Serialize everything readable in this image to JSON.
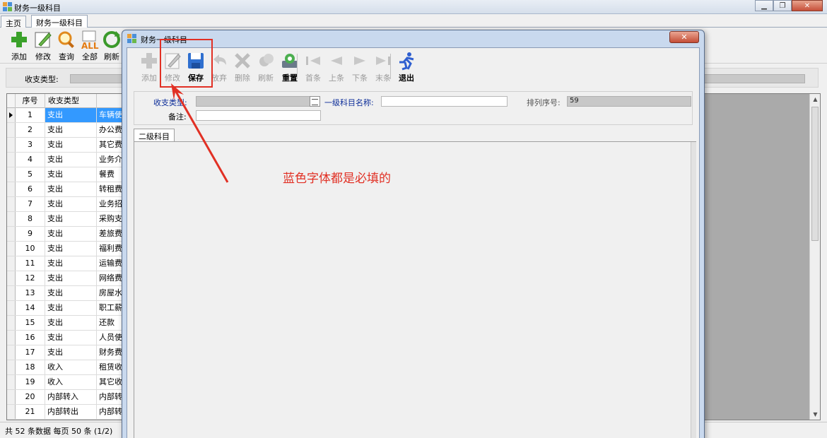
{
  "main_window": {
    "title": "财务一级科目",
    "controls": [
      "▁",
      "❐",
      "✕"
    ]
  },
  "tabs": [
    {
      "label": "主页",
      "active": false
    },
    {
      "label": "财务一级科目",
      "active": true
    }
  ],
  "main_toolbar": {
    "buttons": [
      {
        "label": "添加",
        "icon": "add-icon"
      },
      {
        "label": "修改",
        "icon": "edit-icon"
      },
      {
        "label": "查询",
        "icon": "search-icon"
      },
      {
        "label": "全部",
        "icon": "all-icon"
      },
      {
        "label": "刷新",
        "icon": "refresh-icon"
      }
    ]
  },
  "filter": {
    "label": "收支类型:"
  },
  "grid": {
    "columns": [
      "序号",
      "收支类型"
    ],
    "rows": [
      {
        "no": "1",
        "type": "支出",
        "name": "车辆使"
      },
      {
        "no": "2",
        "type": "支出",
        "name": "办公费"
      },
      {
        "no": "3",
        "type": "支出",
        "name": "其它费"
      },
      {
        "no": "4",
        "type": "支出",
        "name": "业务介"
      },
      {
        "no": "5",
        "type": "支出",
        "name": "餐费"
      },
      {
        "no": "6",
        "type": "支出",
        "name": "转租费"
      },
      {
        "no": "7",
        "type": "支出",
        "name": "业务招"
      },
      {
        "no": "8",
        "type": "支出",
        "name": "采购支"
      },
      {
        "no": "9",
        "type": "支出",
        "name": "差旅费"
      },
      {
        "no": "10",
        "type": "支出",
        "name": "福利费"
      },
      {
        "no": "11",
        "type": "支出",
        "name": "运输费"
      },
      {
        "no": "12",
        "type": "支出",
        "name": "网络费"
      },
      {
        "no": "13",
        "type": "支出",
        "name": "房屋水"
      },
      {
        "no": "14",
        "type": "支出",
        "name": "职工薪"
      },
      {
        "no": "15",
        "type": "支出",
        "name": "还款"
      },
      {
        "no": "16",
        "type": "支出",
        "name": "人员使"
      },
      {
        "no": "17",
        "type": "支出",
        "name": "财务费"
      },
      {
        "no": "18",
        "type": "收入",
        "name": "租赁收"
      },
      {
        "no": "19",
        "type": "收入",
        "name": "其它收"
      },
      {
        "no": "20",
        "type": "内部转入",
        "name": "内部转"
      },
      {
        "no": "21",
        "type": "内部转出",
        "name": "内部转"
      }
    ]
  },
  "status": "共 52 条数据  每页 50 条 (1/2)",
  "dialog": {
    "title": "财务一级科目",
    "close_label": "✕",
    "toolbar": [
      {
        "label": "添加",
        "icon": "add-icon",
        "enabled": false
      },
      {
        "label": "修改",
        "icon": "edit-icon",
        "enabled": false
      },
      {
        "label": "保存",
        "icon": "save-icon",
        "enabled": true
      },
      {
        "label": "放弃",
        "icon": "undo-icon",
        "enabled": false
      },
      {
        "label": "删除",
        "icon": "delete-icon",
        "enabled": false
      },
      {
        "label": "刷新",
        "icon": "refresh-icon",
        "enabled": false
      },
      {
        "label": "重置",
        "icon": "reset-icon",
        "enabled": true
      },
      {
        "label": "首条",
        "icon": "first-icon",
        "enabled": false
      },
      {
        "label": "上条",
        "icon": "prev-icon",
        "enabled": false
      },
      {
        "label": "下条",
        "icon": "next-icon",
        "enabled": false
      },
      {
        "label": "末条",
        "icon": "last-icon",
        "enabled": false
      },
      {
        "label": "退出",
        "icon": "exit-icon",
        "enabled": true
      }
    ],
    "form": {
      "type_label": "收支类型:",
      "name_label": "一级科目名称:",
      "name_value": "",
      "sort_label": "排列序号:",
      "sort_value": "59",
      "note_label": "备注:",
      "note_value": ""
    },
    "subtab": "二级科目"
  },
  "annotation": {
    "text": "蓝色字体都是必填的",
    "color": "#e13024"
  },
  "colors": {
    "required_label": "#0b2c98",
    "selection": "#3399ff"
  }
}
